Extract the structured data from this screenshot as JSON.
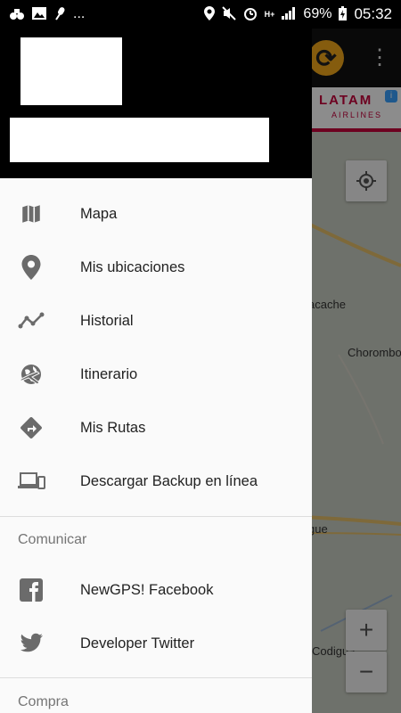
{
  "status_bar": {
    "battery": "69%",
    "time": "05:32",
    "more": "...",
    "network": "H+"
  },
  "ad": {
    "brand": "LATAM",
    "sub": "AIRLINES",
    "info": "i"
  },
  "map": {
    "labels": [
      "acache",
      "Chorombo",
      "gue",
      "Codigua"
    ],
    "zoom_in": "+",
    "zoom_out": "−"
  },
  "drawer": {
    "menu": [
      {
        "label": "Mapa",
        "icon": "map-icon"
      },
      {
        "label": "Mis ubicaciones",
        "icon": "location-pin-icon"
      },
      {
        "label": "Historial",
        "icon": "timeline-icon"
      },
      {
        "label": "Itinerario",
        "icon": "globe-plane-icon"
      },
      {
        "label": "Mis Rutas",
        "icon": "directions-icon"
      },
      {
        "label": "Descargar Backup en línea",
        "icon": "devices-icon"
      }
    ],
    "section_communicate": "Comunicar",
    "social": [
      {
        "label": "NewGPS! Facebook",
        "icon": "facebook-icon"
      },
      {
        "label": "Developer Twitter",
        "icon": "twitter-icon"
      }
    ],
    "section_next": "Compra"
  }
}
